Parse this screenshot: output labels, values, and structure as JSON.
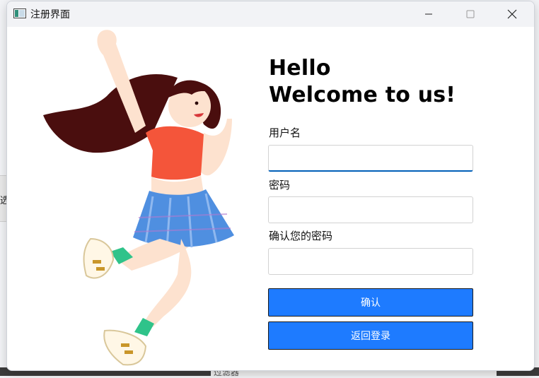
{
  "window": {
    "title": "注册界面",
    "controls": {
      "minimize_icon": "minimize-icon",
      "maximize_icon": "maximize-icon",
      "close_icon": "close-icon"
    }
  },
  "form": {
    "greeting_line1": "Hello",
    "greeting_line2": "Welcome to us!",
    "username_label": "用户名",
    "username_value": "",
    "password_label": "密码",
    "password_value": "",
    "confirm_label": "确认您的密码",
    "confirm_value": "",
    "confirm_button": "确认",
    "back_button": "返回登录"
  },
  "background_hints": {
    "left_glyph": "选",
    "bottom_text": "过滤器"
  },
  "colors": {
    "accent": "#1e7bff",
    "focus_underline": "#005fb8",
    "titlebar": "#f2f3f6"
  }
}
